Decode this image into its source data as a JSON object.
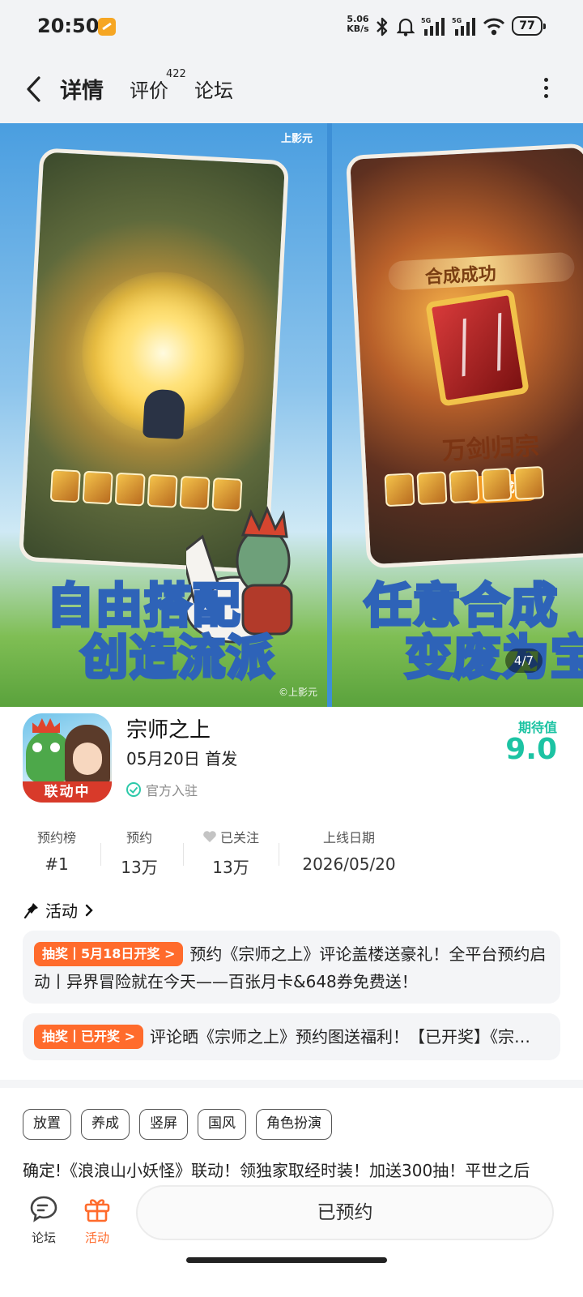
{
  "status_bar": {
    "time": "20:50",
    "net_speed_value": "5.06",
    "net_speed_unit": "KB/s",
    "battery": "77",
    "icons": [
      "bluetooth-icon",
      "bell-icon",
      "signal-5g-icon",
      "signal-5g-icon",
      "wifi-icon",
      "battery-icon"
    ]
  },
  "header": {
    "tabs": [
      {
        "label": "详情",
        "active": true
      },
      {
        "label": "评价",
        "count": "422"
      },
      {
        "label": "论坛"
      }
    ]
  },
  "gallery": {
    "counter": "4/7",
    "shots": [
      {
        "line1_a": "自由",
        "line1_b": "搭",
        "line1_c": "配",
        "line2_a": "创造",
        "line2_b": "流派",
        "watermark_top": "上影元",
        "watermark_bottom": "©上影元"
      },
      {
        "line1_a": "任意",
        "line1_b": "合成",
        "line2_a": "变废",
        "line2_b": "为宝",
        "header_text": "合成成功",
        "sword_title": "万剑归宗",
        "button": "合成"
      }
    ]
  },
  "app": {
    "name": "宗师之上",
    "release": "05月20日 首发",
    "official": "官方入驻",
    "icon_tag": "联动中",
    "expectation_label": "期待值",
    "expectation_score": "9.0"
  },
  "stats": [
    {
      "label": "预约榜",
      "value": "#1"
    },
    {
      "label": "预约",
      "value": "13万"
    },
    {
      "label": "已关注",
      "value": "13万"
    },
    {
      "label": "上线日期",
      "value": "2026/05/20"
    }
  ],
  "activities": {
    "title": "活动",
    "items": [
      {
        "badge": "抽奖丨5月18日开奖 >",
        "text": "预约《宗师之上》评论盖楼送豪礼！全平台预约启动丨异界冒险就在今天——百张月卡&648券免费送！"
      },
      {
        "badge": "抽奖丨已开奖 >",
        "text": "评论晒《宗师之上》预约图送福利！【已开奖】《宗…"
      }
    ]
  },
  "tags": [
    "放置",
    "养成",
    "竖屏",
    "国风",
    "角色扮演"
  ],
  "description": "确定!《浪浪山小妖怪》联动！领独家取经时装！加送300抽！平世之后",
  "bottom_bar": {
    "forum_label": "论坛",
    "activity_label": "活动",
    "reserved_label": "已预约"
  },
  "colors": {
    "accent_teal": "#1cc3a3",
    "badge_orange": "#ff6b2c",
    "text_dark": "#1a1a1a"
  }
}
